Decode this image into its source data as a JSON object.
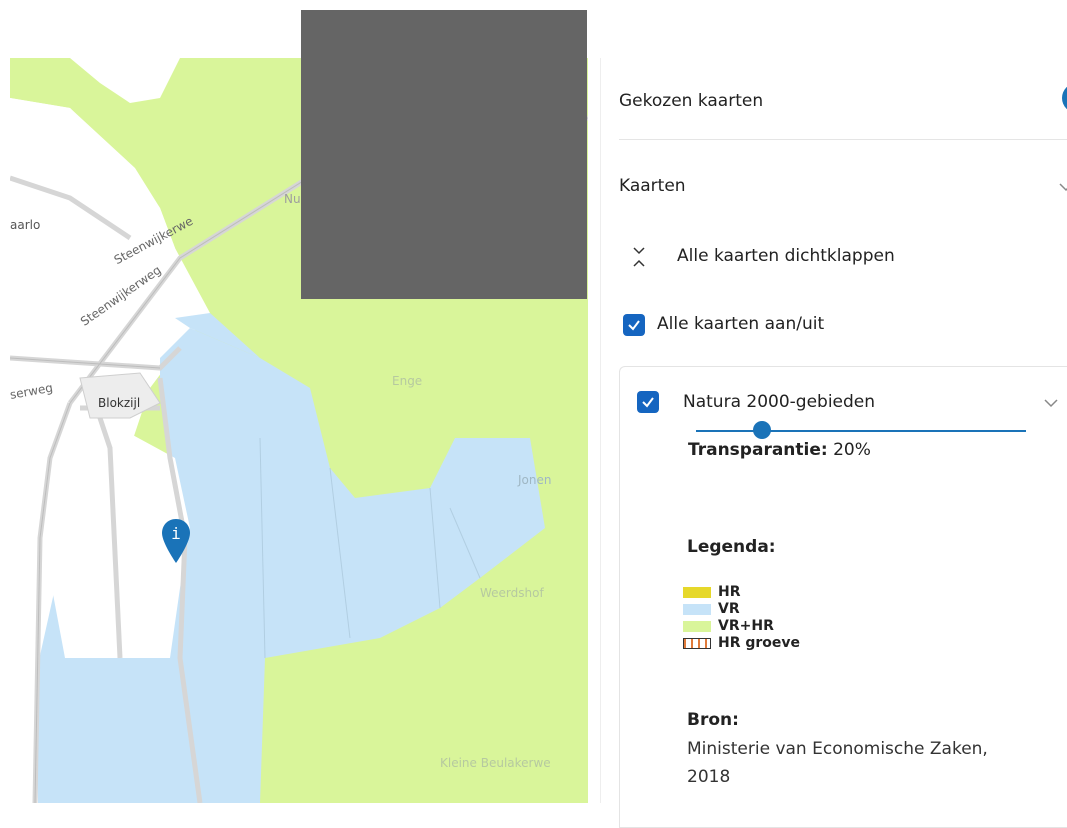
{
  "map": {
    "labels": {
      "place_left": "aarlo",
      "road_steen": "Steenwijkerweg",
      "road_steenwijkerwe": "Steenwijkerwe",
      "road_serweg": "serweg",
      "town": "Blokzijl",
      "area_enge": "Enge",
      "area_jonen": "Jonen",
      "area_hof": "Weerdshof",
      "area_kleine": "Kleine Beulakerwe",
      "area_n": "Nu"
    },
    "marker_icon": "info-marker-icon",
    "colors": {
      "vr": "#c6e3f8",
      "vr_hr": "#d9f59a",
      "road": "#d9d9d9"
    }
  },
  "panel": {
    "chosen_maps": "Gekozen kaarten",
    "maps": "Kaarten",
    "collapse_all": "Alle kaarten dichtklappen",
    "toggle_all": "Alle kaarten aan/uit",
    "layer": {
      "name": "Natura 2000-gebieden",
      "checked": true,
      "transparency_label": "Transparantie:",
      "transparency_value": "20%",
      "transparency_fraction": 0.2,
      "legend_title": "Legenda:",
      "legend": [
        {
          "label": "HR",
          "color": "#e6d82a"
        },
        {
          "label": "VR",
          "color": "#c6e3f8"
        },
        {
          "label": "VR+HR",
          "color": "#d9f59a"
        },
        {
          "label": "HR groeve",
          "color": "#ffffff",
          "border": "#e07a3a"
        }
      ],
      "source_title": "Bron:",
      "source_line1": "Ministerie van Economische Zaken,",
      "source_line2": "2018"
    },
    "accent": "#1a73b8"
  }
}
